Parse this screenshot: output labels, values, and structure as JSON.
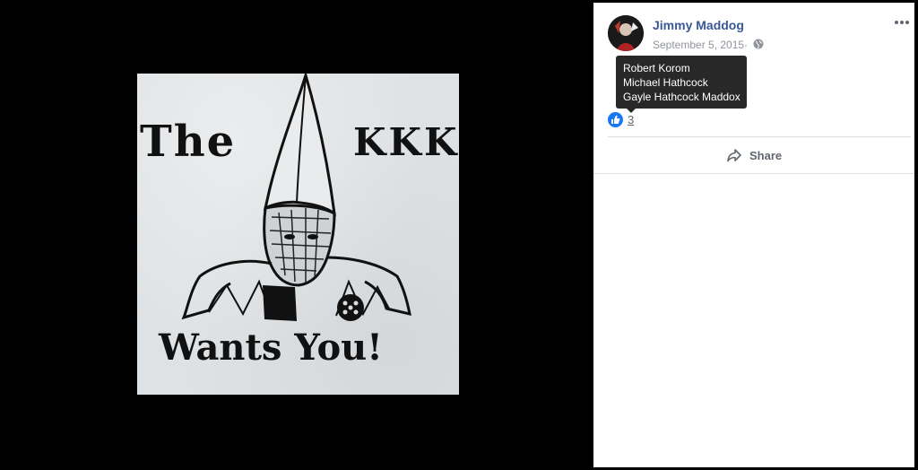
{
  "photo": {
    "text_top_left": "The",
    "text_top_right": "KKK",
    "text_bottom": "Wants You!"
  },
  "post": {
    "author": "Jimmy Maddog",
    "date": "September 5, 2015",
    "separator": "·",
    "audience_icon": "globe-icon",
    "more_icon": "ellipsis-icon"
  },
  "reactions": {
    "icon": "like-icon",
    "count": "3",
    "tooltip_names": [
      "Robert Korom",
      "Michael Hathcock",
      "Gayle Hathcock Maddox"
    ]
  },
  "actions": {
    "share_label": "Share",
    "share_icon": "share-arrow-icon"
  },
  "colors": {
    "name_link": "#385898",
    "like_blue": "#1877f2",
    "meta_gray": "#90949c",
    "tooltip_bg": "#282828"
  }
}
